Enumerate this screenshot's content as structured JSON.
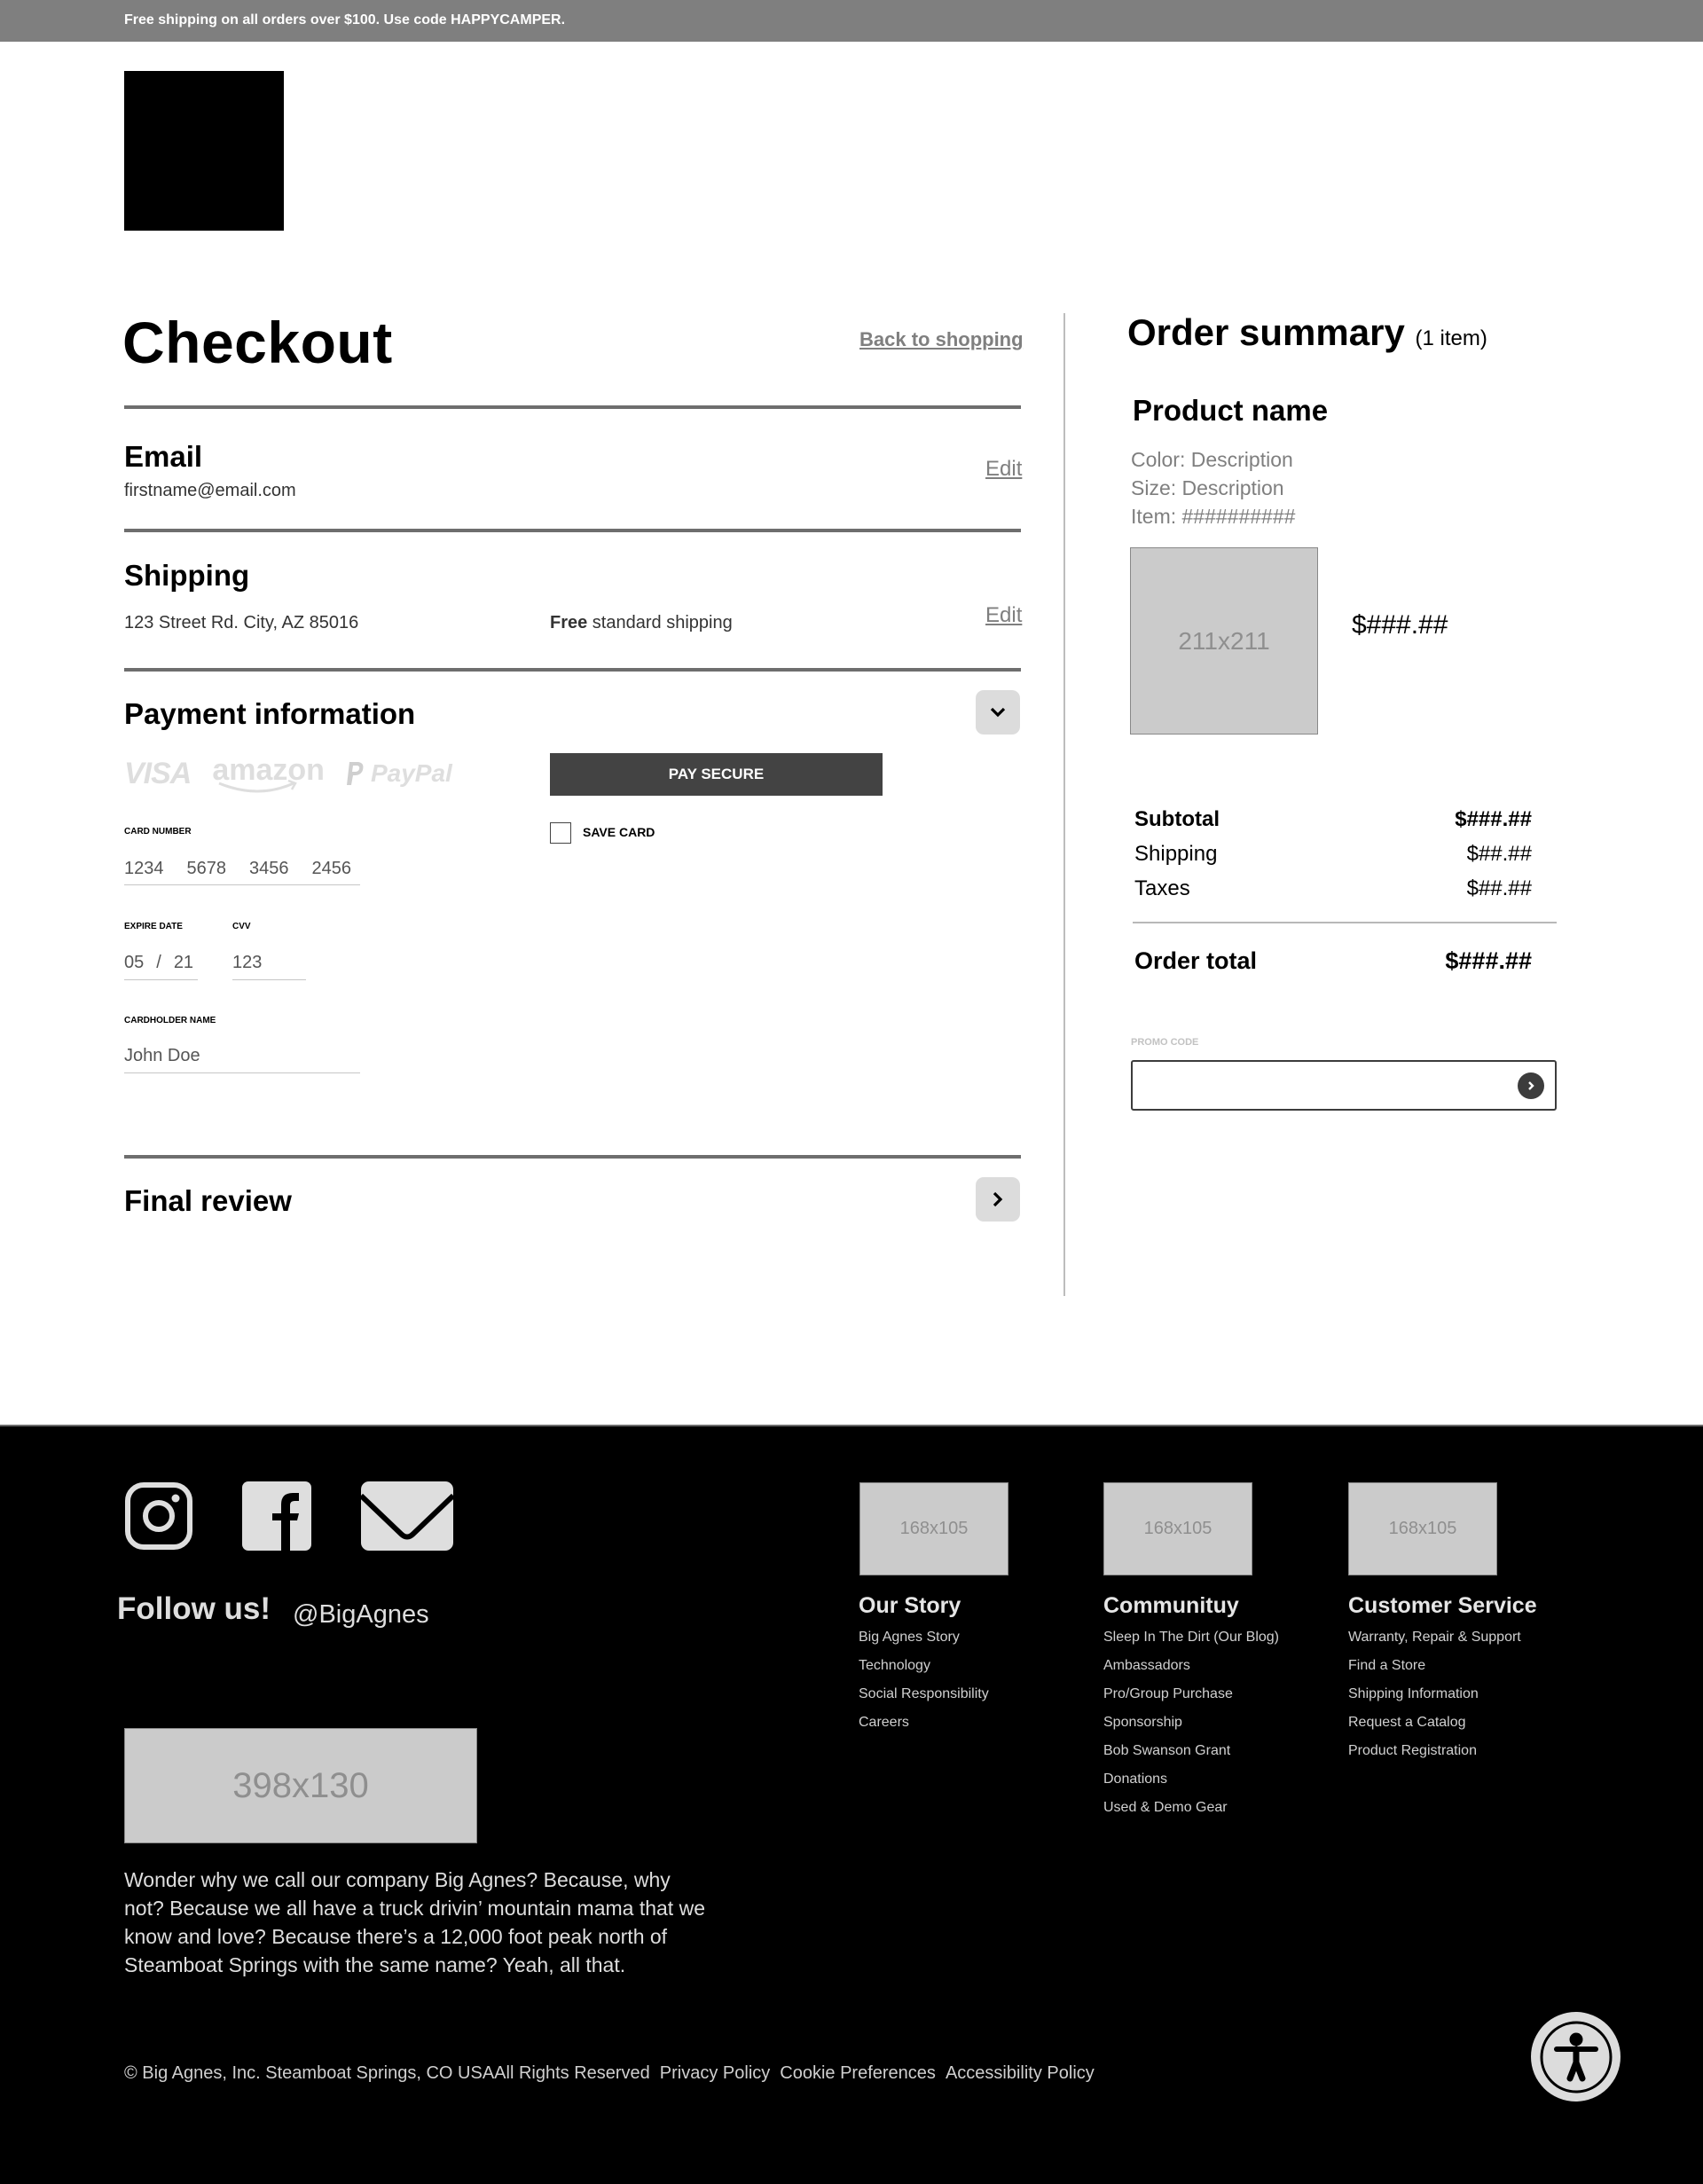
{
  "banner": {
    "text": "Free shipping on all orders over $100.  Use code HAPPYCAMPER."
  },
  "header": {
    "logo": "logo"
  },
  "checkout": {
    "title": "Checkout",
    "back_link": "Back to shopping",
    "email": {
      "title": "Email",
      "value": "firstname@email.com",
      "edit": "Edit"
    },
    "shipping": {
      "title": "Shipping",
      "address": "123 Street Rd. City,  AZ 85016",
      "method_bold": "Free",
      "method_rest": " standard shipping",
      "edit": "Edit"
    },
    "payment": {
      "title": "Payment information",
      "toggle_icon": "chevron-down-icon",
      "logos": {
        "visa": "VISA",
        "amazon": "amazon",
        "paypal": "PayPal"
      },
      "pay_button": "PAY SECURE",
      "save_card": {
        "label": "SAVE CARD",
        "checked": false
      },
      "card_number": {
        "label": "CARD NUMBER",
        "groups": [
          "1234",
          "5678",
          "3456",
          "2456"
        ]
      },
      "expire": {
        "label": "EXPIRE DATE",
        "month": "05",
        "separator": "/",
        "year": "21"
      },
      "cvv": {
        "label": "CVV",
        "value": "123"
      },
      "cardholder": {
        "label": "CARDHOLDER NAME",
        "value": "John Doe"
      }
    },
    "final_review": {
      "title": "Final review",
      "toggle_icon": "chevron-right-icon"
    }
  },
  "order_summary": {
    "title": "Order summary",
    "count": "(1 item)",
    "product": {
      "name": "Product name",
      "color": "Color: Description",
      "size": "Size: Description",
      "item": "Item: ##########",
      "image_placeholder": "211x211",
      "price": "$###.##"
    },
    "rows": [
      {
        "label": "Subtotal",
        "value": "$###.##",
        "bold": true
      },
      {
        "label": "Shipping",
        "value": "$##.##",
        "bold": false
      },
      {
        "label": "Taxes",
        "value": "$##.##",
        "bold": false
      }
    ],
    "total": {
      "label": "Order total",
      "value": "$###.##"
    },
    "promo": {
      "label": "PROMO CODE",
      "value": "",
      "placeholder": ""
    }
  },
  "footer": {
    "social": [
      "instagram-icon",
      "facebook-icon",
      "email-icon"
    ],
    "follow": "Follow us!",
    "handle": "@BigAgnes",
    "hero_placeholder": "398x130",
    "about": "Wonder why we call our company Big Agnes? Because, why not? Because we all have a truck drivin’ mountain mama that we know and love? Because there’s a 12,000 foot peak north of Steamboat Springs with the same name? Yeah, all that.",
    "columns": [
      {
        "image_placeholder": "168x105",
        "title": "Our Story",
        "links": [
          "Big Agnes Story",
          "Technology",
          "Social Responsibility",
          "Careers"
        ]
      },
      {
        "image_placeholder": "168x105",
        "title": "Communituy",
        "links": [
          "Sleep In The Dirt (Our Blog)",
          "Ambassadors",
          "Pro/Group Purchase",
          "Sponsorship",
          "Bob Swanson Grant",
          "Donations",
          "Used & Demo Gear"
        ]
      },
      {
        "image_placeholder": "168x105",
        "title": "Customer Service",
        "links": [
          "Warranty, Repair & Support",
          "Find a Store",
          "Shipping Information",
          "Request a Catalog",
          "Product Registration"
        ]
      }
    ],
    "legal": {
      "copyright": "© Big Agnes, Inc. Steamboat Springs, CO USAAll Rights Reserved",
      "links": [
        "Privacy Policy",
        "Cookie Preferences",
        "Accessibility Policy"
      ]
    },
    "accessibility_button": "accessibility-icon"
  }
}
